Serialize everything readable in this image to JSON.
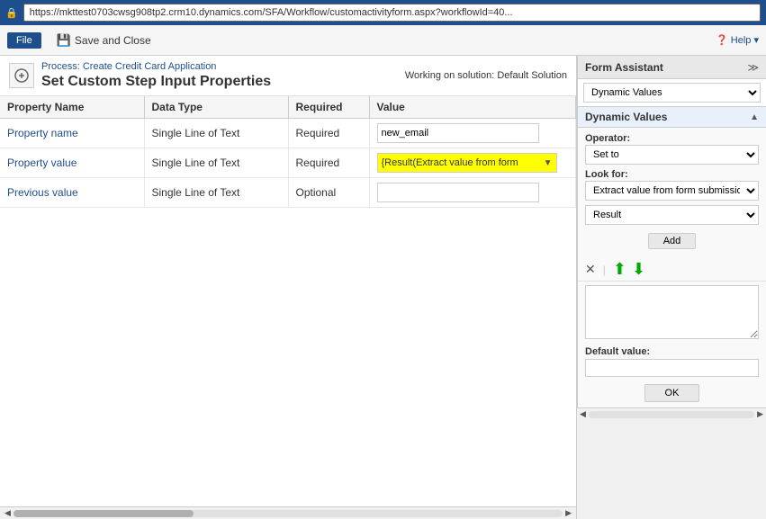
{
  "browser": {
    "url": "https://mkttest0703cwsg908tp2.crm10.dynamics.com/SFA/Workflow/customactivityform.aspx?workflowId=40...",
    "lock_icon": "🔒"
  },
  "toolbar": {
    "file_label": "File",
    "save_close_label": "Save and Close",
    "help_label": "❓ Help ▾"
  },
  "process": {
    "link_label": "Process: Create Credit Card Application",
    "form_title": "Set Custom Step Input Properties",
    "solution_label": "Working on solution: Default Solution"
  },
  "table": {
    "headers": [
      "Property Name",
      "Data Type",
      "Required",
      "Value"
    ],
    "rows": [
      {
        "property_name": "Property name",
        "data_type": "Single Line of Text",
        "required": "Required",
        "value": "new_email",
        "value_type": "text"
      },
      {
        "property_name": "Property value",
        "data_type": "Single Line of Text",
        "required": "Required",
        "value": "{Result(Extract value from form",
        "value_type": "dynamic"
      },
      {
        "property_name": "Previous value",
        "data_type": "Single Line of Text",
        "required": "Optional",
        "value": "",
        "value_type": "text"
      }
    ]
  },
  "form_assistant": {
    "title": "Form Assistant",
    "expand_icon": "≫",
    "top_dropdown_value": "Dynamic Values",
    "section_title": "Dynamic Values",
    "operator_label": "Operator:",
    "operator_value": "Set to",
    "look_for_label": "Look for:",
    "look_for_value": "Extract value from form submission",
    "result_value": "Result",
    "add_button": "Add",
    "delete_icon": "✕",
    "up_icon": "▲",
    "down_icon": "▼",
    "default_value_label": "Default value:",
    "ok_button": "OK"
  }
}
